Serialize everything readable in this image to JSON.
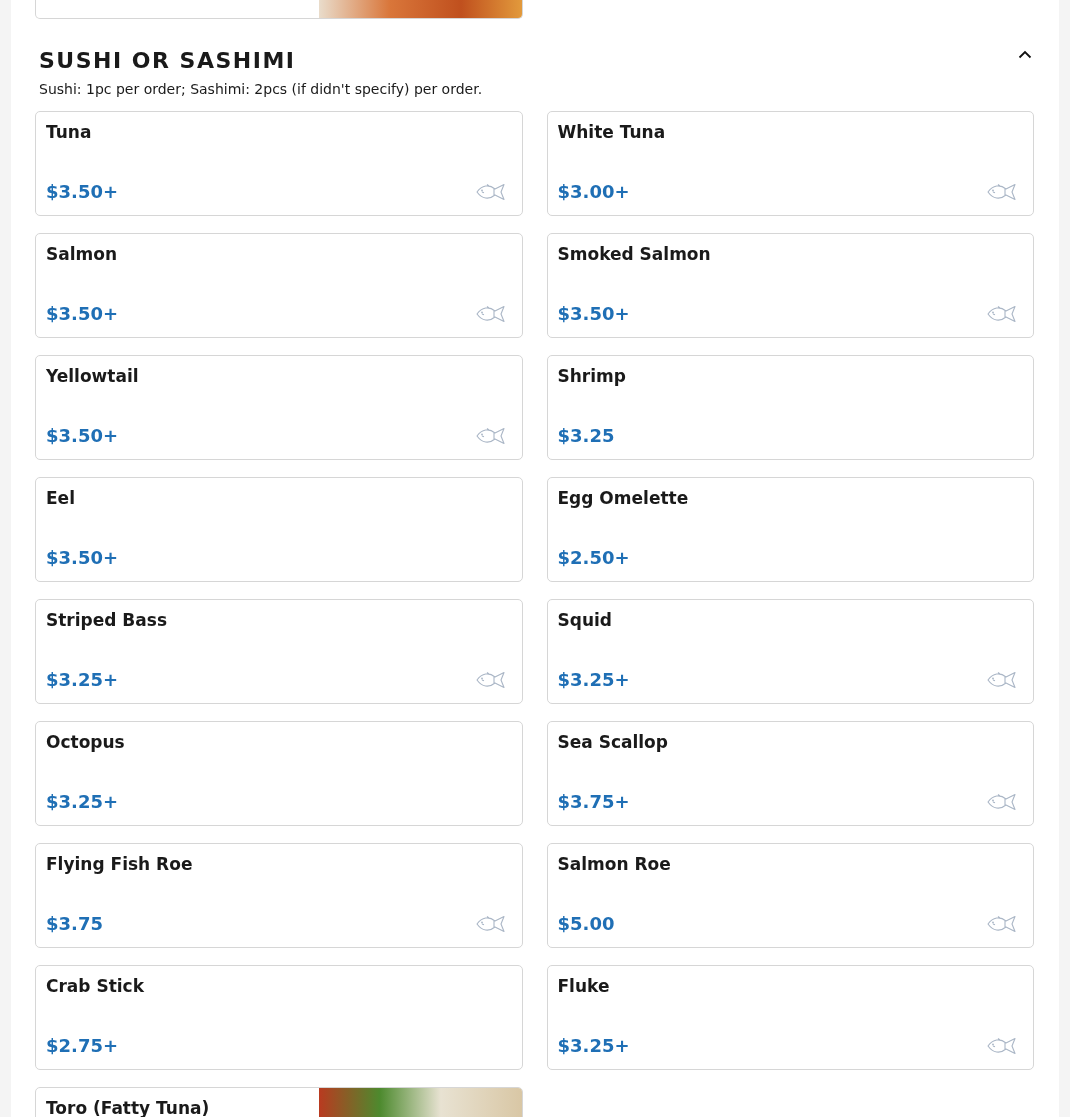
{
  "previous_item": {
    "has_photo": true
  },
  "section": {
    "title": "SUSHI OR SASHIMI",
    "expanded": true,
    "note": "Sushi: 1pc per order; Sashimi: 2pcs (if didn't specify) per order.",
    "items": [
      {
        "name": "Tuna",
        "price": "$3.50+",
        "raw_fish": true,
        "has_photo": false
      },
      {
        "name": "White Tuna",
        "price": "$3.00+",
        "raw_fish": true,
        "has_photo": false
      },
      {
        "name": "Salmon",
        "price": "$3.50+",
        "raw_fish": true,
        "has_photo": false
      },
      {
        "name": "Smoked Salmon",
        "price": "$3.50+",
        "raw_fish": true,
        "has_photo": false
      },
      {
        "name": "Yellowtail",
        "price": "$3.50+",
        "raw_fish": true,
        "has_photo": false
      },
      {
        "name": "Shrimp",
        "price": "$3.25",
        "raw_fish": false,
        "has_photo": false
      },
      {
        "name": "Eel",
        "price": "$3.50+",
        "raw_fish": false,
        "has_photo": false
      },
      {
        "name": "Egg Omelette",
        "price": "$2.50+",
        "raw_fish": false,
        "has_photo": false
      },
      {
        "name": "Striped Bass",
        "price": "$3.25+",
        "raw_fish": true,
        "has_photo": false
      },
      {
        "name": "Squid",
        "price": "$3.25+",
        "raw_fish": true,
        "has_photo": false
      },
      {
        "name": "Octopus",
        "price": "$3.25+",
        "raw_fish": false,
        "has_photo": false
      },
      {
        "name": "Sea Scallop",
        "price": "$3.75+",
        "raw_fish": true,
        "has_photo": false
      },
      {
        "name": "Flying Fish Roe",
        "price": "$3.75",
        "raw_fish": true,
        "has_photo": false
      },
      {
        "name": "Salmon Roe",
        "price": "$5.00",
        "raw_fish": true,
        "has_photo": false
      },
      {
        "name": "Crab Stick",
        "price": "$2.75+",
        "raw_fish": false,
        "has_photo": false
      },
      {
        "name": "Fluke",
        "price": "$3.25+",
        "raw_fish": true,
        "has_photo": false
      },
      {
        "name": "Toro (Fatty Tuna)",
        "raw_fish": false,
        "has_photo": true
      }
    ]
  }
}
